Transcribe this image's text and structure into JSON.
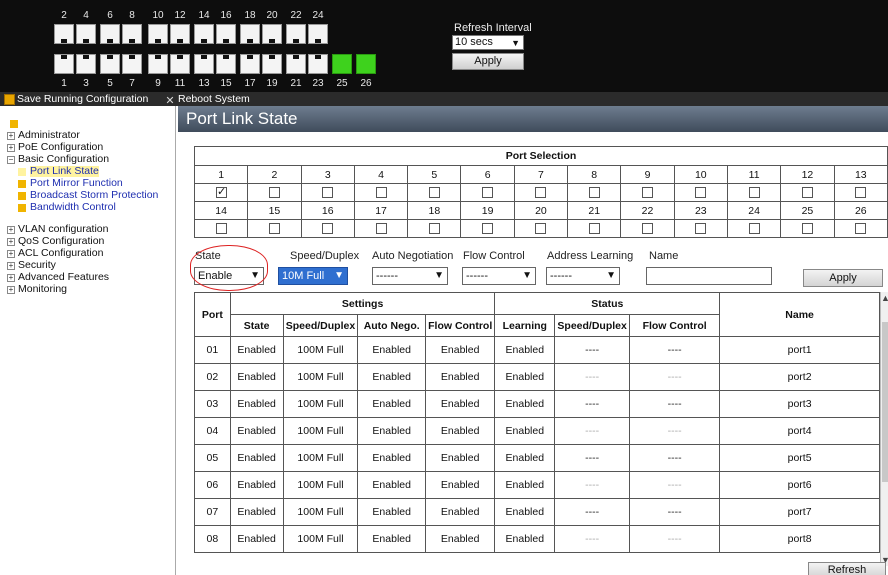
{
  "banner": {
    "top_numbers": [
      "2",
      "4",
      "6",
      "8",
      "10",
      "12",
      "14",
      "16",
      "18",
      "20",
      "22",
      "24"
    ],
    "bottom_numbers": [
      "1",
      "3",
      "5",
      "7",
      "9",
      "11",
      "13",
      "15",
      "17",
      "19",
      "21",
      "23",
      "25",
      "26"
    ],
    "green_ports": [
      "25",
      "26"
    ],
    "refresh_label": "Refresh Interval",
    "refresh_value": "10 secs",
    "apply_label": "Apply"
  },
  "toolbar": {
    "save_label": "Save Running Configuration",
    "reboot_label": "Reboot System",
    "save_icon": "save-icon",
    "reboot_icon": "tools-icon"
  },
  "nav": {
    "items": [
      {
        "label": "Administrator",
        "expander": "+"
      },
      {
        "label": "PoE Configuration",
        "expander": "+"
      },
      {
        "label": "Basic Configuration",
        "expander": "−"
      },
      {
        "label": "VLAN configuration",
        "expander": "+"
      },
      {
        "label": "QoS Configuration",
        "expander": "+"
      },
      {
        "label": "ACL Configuration",
        "expander": "+"
      },
      {
        "label": "Security",
        "expander": "+"
      },
      {
        "label": "Advanced Features",
        "expander": "+"
      },
      {
        "label": "Monitoring",
        "expander": "+"
      }
    ],
    "subitems": [
      {
        "label": "Port Link State",
        "active": true
      },
      {
        "label": "Port Mirror Function",
        "active": false
      },
      {
        "label": "Broadcast Storm Protection",
        "active": false
      },
      {
        "label": "Bandwidth Control",
        "active": false
      }
    ]
  },
  "page": {
    "title": "Port Link State",
    "port_selection_header": "Port Selection",
    "ports_row1": [
      "1",
      "2",
      "3",
      "4",
      "5",
      "6",
      "7",
      "8",
      "9",
      "10",
      "11",
      "12",
      "13"
    ],
    "ports_row2": [
      "14",
      "15",
      "16",
      "17",
      "18",
      "19",
      "20",
      "21",
      "22",
      "23",
      "24",
      "25",
      "26"
    ],
    "checked_ports": [
      "1"
    ]
  },
  "settings_form": {
    "state_label": "State",
    "speed_label": "Speed/Duplex",
    "autoneg_label": "Auto Negotiation",
    "flow_label": "Flow Control",
    "learning_label": "Address Learning",
    "name_label": "Name",
    "state_value": "Enable",
    "speed_value": "10M Full",
    "autoneg_value": "------",
    "flow_value": "------",
    "learning_value": "------",
    "name_value": "",
    "apply_label": "Apply"
  },
  "status_table": {
    "group_headers": {
      "settings": "Settings",
      "status": "Status"
    },
    "columns": {
      "port": "Port",
      "state": "State",
      "speed": "Speed/Duplex",
      "autoneg": "Auto Nego.",
      "flow": "Flow Control",
      "learning": "Learning",
      "status_speed": "Speed/Duplex",
      "status_flow": "Flow Control",
      "name": "Name"
    },
    "rows": [
      {
        "port": "01",
        "state": "Enabled",
        "speed": "100M Full",
        "autoneg": "Enabled",
        "flow": "Enabled",
        "learning": "Enabled",
        "status_speed": "----",
        "status_flow": "----",
        "name": "port1"
      },
      {
        "port": "02",
        "state": "Enabled",
        "speed": "100M Full",
        "autoneg": "Enabled",
        "flow": "Enabled",
        "learning": "Enabled",
        "status_speed": "----",
        "status_flow": "----",
        "name": "port2"
      },
      {
        "port": "03",
        "state": "Enabled",
        "speed": "100M Full",
        "autoneg": "Enabled",
        "flow": "Enabled",
        "learning": "Enabled",
        "status_speed": "----",
        "status_flow": "----",
        "name": "port3"
      },
      {
        "port": "04",
        "state": "Enabled",
        "speed": "100M Full",
        "autoneg": "Enabled",
        "flow": "Enabled",
        "learning": "Enabled",
        "status_speed": "----",
        "status_flow": "----",
        "name": "port4"
      },
      {
        "port": "05",
        "state": "Enabled",
        "speed": "100M Full",
        "autoneg": "Enabled",
        "flow": "Enabled",
        "learning": "Enabled",
        "status_speed": "----",
        "status_flow": "----",
        "name": "port5"
      },
      {
        "port": "06",
        "state": "Enabled",
        "speed": "100M Full",
        "autoneg": "Enabled",
        "flow": "Enabled",
        "learning": "Enabled",
        "status_speed": "----",
        "status_flow": "----",
        "name": "port6"
      },
      {
        "port": "07",
        "state": "Enabled",
        "speed": "100M Full",
        "autoneg": "Enabled",
        "flow": "Enabled",
        "learning": "Enabled",
        "status_speed": "----",
        "status_flow": "----",
        "name": "port7"
      },
      {
        "port": "08",
        "state": "Enabled",
        "speed": "100M Full",
        "autoneg": "Enabled",
        "flow": "Enabled",
        "learning": "Enabled",
        "status_speed": "----",
        "status_flow": "----",
        "name": "port8"
      }
    ]
  },
  "footer": {
    "refresh_label": "Refresh"
  },
  "colors": {
    "banner_bg": "#0d0d0d",
    "title_bar": "#4b5869",
    "link_port": "#3ed21d",
    "nav_link": "#1f2fb0",
    "highlight_select": "#2f6fd0",
    "annotation": "#dd2222"
  }
}
